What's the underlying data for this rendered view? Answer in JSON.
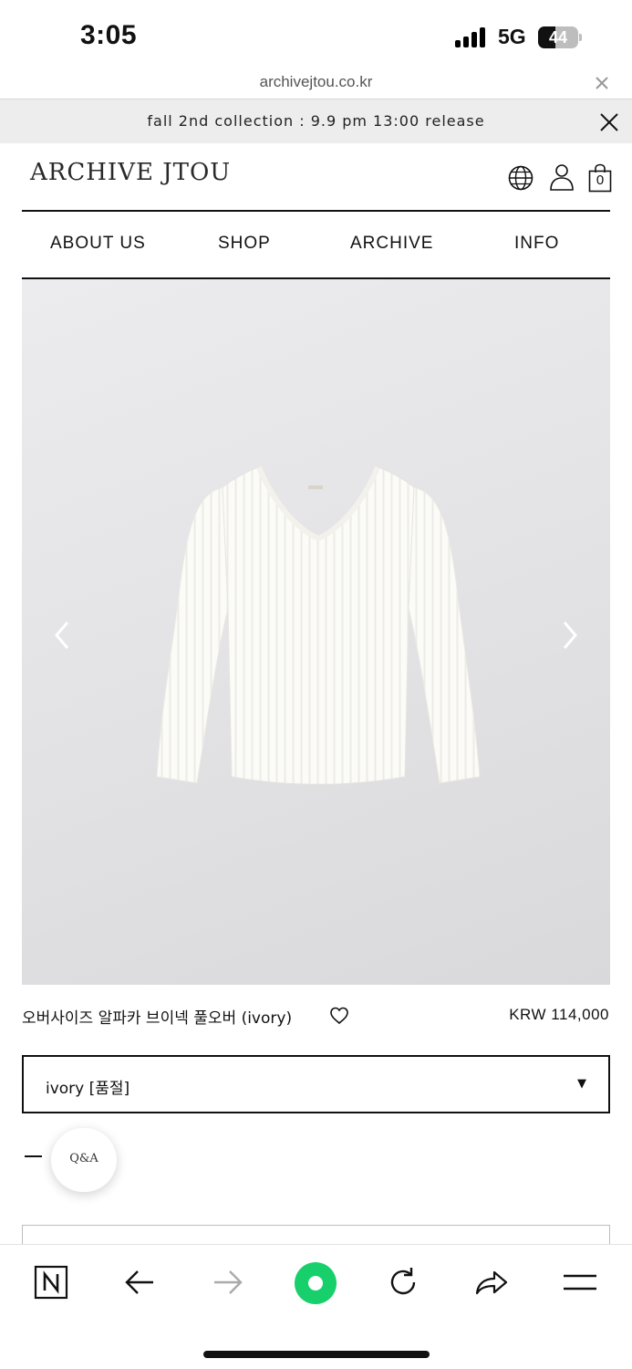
{
  "status_bar": {
    "time": "3:05",
    "network": "5G",
    "battery": "44",
    "battery_level": 0.44
  },
  "browser": {
    "url": "archivejtou.co.kr"
  },
  "announcement": {
    "text": "fall 2nd collection : 9.9 pm 13:00 release"
  },
  "header": {
    "logo": "ARCHIVE JTOU",
    "cart_count": "0"
  },
  "nav": {
    "items": [
      "ABOUT US",
      "SHOP",
      "ARCHIVE",
      "INFO"
    ]
  },
  "product": {
    "name": "오버사이즈 알파카 브이넥 풀오버 (ivory)",
    "price": "KRW 114,000",
    "selected_option": "ivory [품절]",
    "option_caret": "▼"
  },
  "floating": {
    "qa_label": "Q&A"
  },
  "colors": {
    "accent_green": "#17d06b",
    "announcement_bg": "#ededed"
  },
  "icons": [
    "globe-icon",
    "user-icon",
    "bag-icon",
    "heart-icon",
    "close-icon",
    "chevron-left-icon",
    "chevron-right-icon",
    "naver-n-icon",
    "back-arrow-icon",
    "forward-arrow-icon",
    "green-dot-icon",
    "refresh-icon",
    "share-icon",
    "menu-icon"
  ]
}
